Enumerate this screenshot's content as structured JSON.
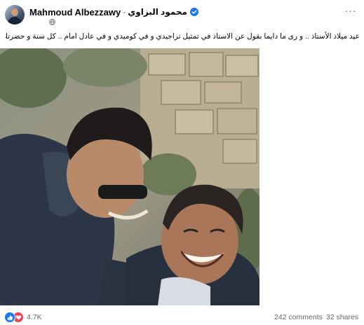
{
  "post": {
    "author_name": "Mahmoud Albezzawy",
    "author_name_separator": "-",
    "author_name_alt": "محمود البزاوي",
    "privacy_icon": "globe-icon",
    "more_icon": "more-horizontal-icon",
    "more_label": "···",
    "verified_icon": "verified-badge-icon",
    "text": "عيد ميلاد الأستاذ .. و رى ما دايما بقول عن الاستاذ في تمثيل تراجيدي و في كوميدي و في عادل امام .. كل سنة و حضرتك طيب يا زعيم",
    "text_emoji": "❤️"
  },
  "photo": {
    "semantic": "two men laughing embrace outdoors",
    "alt": ""
  },
  "footer": {
    "reaction_icons": [
      "like-icon",
      "love-icon"
    ],
    "reaction_count": "4.7K",
    "comments": "242 comments",
    "shares": "32 shares"
  },
  "colors": {
    "brand_blue": "#1877f2",
    "love_red": "#f33e58",
    "secondary_text": "#65676b",
    "primary_text": "#050505"
  }
}
